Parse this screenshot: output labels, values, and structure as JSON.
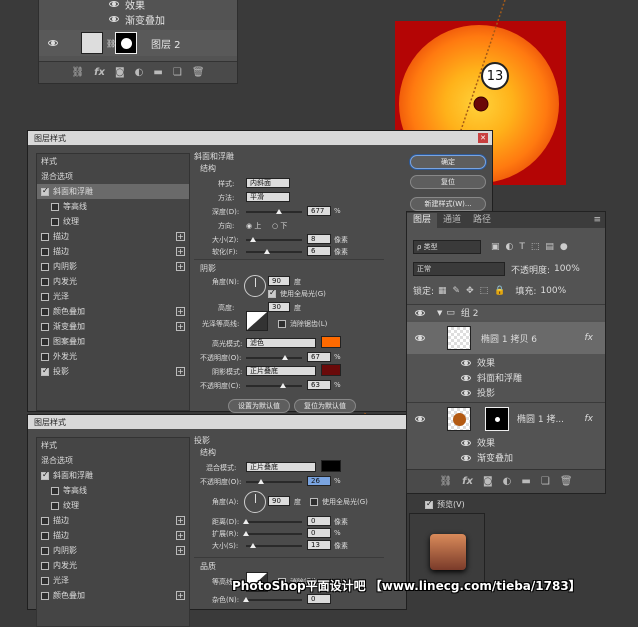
{
  "top_layers": {
    "effects_label": "效果",
    "gradient_overlay": "渐变叠加",
    "layer2_name": "图层 2"
  },
  "annotation": {
    "number": "13"
  },
  "dialog1": {
    "title": "图层样式",
    "list": {
      "styles": "样式",
      "blend_options": "混合选项",
      "bevel": "斜面和浮雕",
      "contour": "等高线",
      "texture": "纹理",
      "stroke1": "描边",
      "stroke2": "描边",
      "inner_shadow": "内阴影",
      "inner_glow": "内发光",
      "satin": "光泽",
      "color_overlay": "颜色叠加",
      "gradient_overlay": "渐变叠加",
      "pattern_overlay": "图案叠加",
      "outer_glow": "外发光",
      "drop_shadow": "投影"
    },
    "section_title": "斜面和浮雕",
    "structure": "结构",
    "style_label": "样式:",
    "style_value": "内斜面",
    "technique_label": "方法:",
    "technique_value": "平滑",
    "depth_label": "深度(D):",
    "depth_value": "677",
    "depth_unit": "%",
    "direction_label": "方向:",
    "dir_up": "上",
    "dir_down": "下",
    "size_label": "大小(Z):",
    "size_value": "8",
    "size_unit": "像素",
    "soften_label": "软化(F):",
    "soften_value": "6",
    "soften_unit": "像素",
    "shading": "阴影",
    "angle_label": "角度(N):",
    "angle_value": "90",
    "angle_unit": "度",
    "global_light": "使用全局光(G)",
    "altitude_label": "高度:",
    "altitude_value": "30",
    "altitude_unit": "度",
    "gloss_label": "光泽等高线:",
    "antialias": "消除锯齿(L)",
    "highlight_label": "高光模式:",
    "highlight_value": "滤色",
    "hl_opacity_label": "不透明度(O):",
    "hl_opacity_value": "67",
    "hl_opacity_unit": "%",
    "shadow_label": "阴影模式:",
    "shadow_value": "正片叠底",
    "sh_opacity_label": "不透明度(C):",
    "sh_opacity_value": "63",
    "sh_opacity_unit": "%",
    "set_default": "设置为默认值",
    "reset_default": "复位为默认值",
    "ok": "确定",
    "reset": "复位",
    "new_style": "新建样式(W)...",
    "hl_color": "#ff6a00",
    "sh_color": "#6a0a0a"
  },
  "dialog2": {
    "title": "图层样式",
    "list": {
      "styles": "样式",
      "blend_options": "混合选项",
      "bevel": "斜面和浮雕",
      "contour": "等高线",
      "texture": "纹理",
      "stroke1": "描边",
      "stroke2": "描边",
      "inner_shadow": "内阴影",
      "inner_glow": "内发光",
      "satin": "光泽",
      "color_overlay": "颜色叠加"
    },
    "section_title": "投影",
    "structure": "结构",
    "blend_label": "混合模式:",
    "blend_value": "正片叠底",
    "opacity_label": "不透明度(O):",
    "opacity_value": "26",
    "opacity_unit": "%",
    "angle_label": "角度(A):",
    "angle_value": "90",
    "angle_unit": "度",
    "global_light": "使用全局光(G)",
    "distance_label": "距离(D):",
    "distance_value": "0",
    "distance_unit": "像素",
    "spread_label": "扩展(R):",
    "spread_value": "0",
    "spread_unit": "%",
    "size_label": "大小(S):",
    "size_value": "13",
    "size_unit": "像素",
    "quality": "品质",
    "contour_label": "等高线:",
    "antialias": "消除锯齿",
    "noise_label": "杂色(N):",
    "noise_value": "0",
    "preview": "预览(V)",
    "shadow_color": "#000000"
  },
  "layers_panel": {
    "tabs": [
      "图层",
      "通道",
      "路径"
    ],
    "kind_label": "ρ 类型",
    "blend_mode": "正常",
    "opacity_label": "不透明度:",
    "opacity_value": "100%",
    "lock_label": "锁定:",
    "fill_label": "填充:",
    "fill_value": "100%",
    "group_name": "组 2",
    "layer_copy6": "椭圆 1 拷贝 6",
    "effects1": "效果",
    "bevel1": "斜面和浮雕",
    "shadow1": "投影",
    "layer_copy": "椭圆 1 拷...",
    "effects2": "效果",
    "gradient2": "渐变叠加"
  },
  "watermark": "PhotoShop平面设计吧 【www.linecg.com/tieba/1783】"
}
